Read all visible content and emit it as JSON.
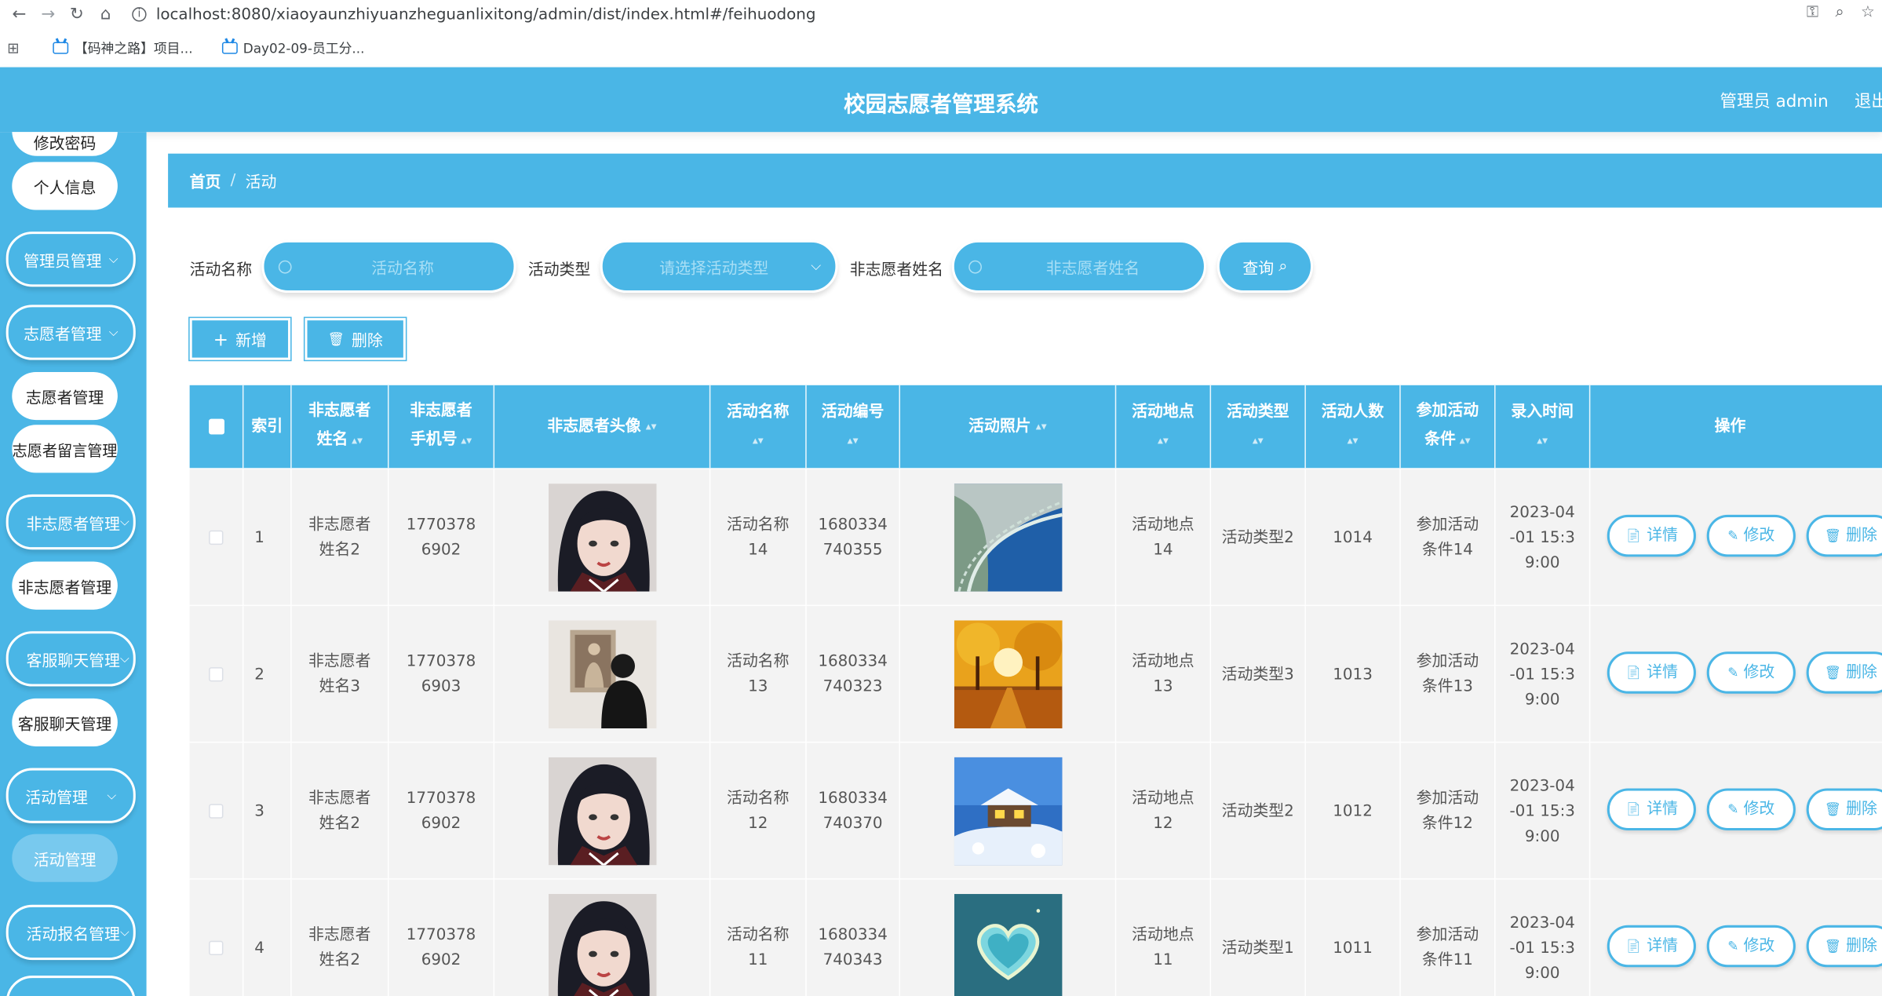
{
  "browser": {
    "url": "localhost:8080/xiaoyaunzhiyuanzheguanlixitong/admin/dist/index.html#/feihuodong",
    "bookmarks": [
      "【码神之路】项目...",
      "Day02-09-员工分..."
    ]
  },
  "header": {
    "title": "校园志愿者管理系统",
    "admin": "管理员 admin",
    "logout": "退出"
  },
  "sidebar": {
    "items": [
      {
        "label": "修改密码"
      },
      {
        "label": "个人信息"
      },
      {
        "label": "管理员管理"
      },
      {
        "label": "志愿者管理"
      },
      {
        "label": "志愿者管理"
      },
      {
        "label": "志愿者留言管理"
      },
      {
        "label": "非志愿者管理"
      },
      {
        "label": "非志愿者管理"
      },
      {
        "label": "客服聊天管理"
      },
      {
        "label": "客服聊天管理"
      },
      {
        "label": "活动管理"
      },
      {
        "label": "活动管理"
      },
      {
        "label": "活动报名管理"
      }
    ]
  },
  "breadcrumb": {
    "home": "首页",
    "current": "活动"
  },
  "filters": {
    "name_label": "活动名称",
    "name_placeholder": "活动名称",
    "type_label": "活动类型",
    "type_placeholder": "请选择活动类型",
    "person_label": "非志愿者姓名",
    "person_placeholder": "非志愿者姓名",
    "query": "查询"
  },
  "actions": {
    "add": "新增",
    "delete": "删除"
  },
  "table": {
    "headers": [
      "索引",
      "非志愿者姓名",
      "非志愿者手机号",
      "非志愿者头像",
      "活动名称",
      "活动编号",
      "活动照片",
      "活动地点",
      "活动类型",
      "活动人数",
      "参加活动条件",
      "录入时间",
      "操作"
    ],
    "ops": {
      "detail": "详情",
      "edit": "修改",
      "delete": "删除"
    },
    "rows": [
      {
        "index": "1",
        "name": "非志愿者姓名2",
        "phone": "17703786902",
        "avatar": "girl-portrait",
        "activity": "活动名称14",
        "code": "1680334740355",
        "photo": "coastline",
        "place": "活动地点14",
        "type": "活动类型2",
        "count": "1014",
        "condition": "参加活动条件14",
        "time": "2023-04-01 15:39:00"
      },
      {
        "index": "2",
        "name": "非志愿者姓名3",
        "phone": "17703786903",
        "avatar": "gallery-visitor",
        "activity": "活动名称13",
        "code": "1680334740323",
        "photo": "autumn-trees",
        "place": "活动地点13",
        "type": "活动类型3",
        "count": "1013",
        "condition": "参加活动条件13",
        "time": "2023-04-01 15:39:00"
      },
      {
        "index": "3",
        "name": "非志愿者姓名2",
        "phone": "17703786902",
        "avatar": "girl-portrait",
        "activity": "活动名称12",
        "code": "1680334740370",
        "photo": "snow-house",
        "place": "活动地点12",
        "type": "活动类型2",
        "count": "1012",
        "condition": "参加活动条件12",
        "time": "2023-04-01 15:39:00"
      },
      {
        "index": "4",
        "name": "非志愿者姓名2",
        "phone": "17703786902",
        "avatar": "girl-portrait",
        "activity": "活动名称11",
        "code": "1680334740343",
        "photo": "heart-island",
        "place": "活动地点11",
        "type": "活动类型1",
        "count": "1011",
        "condition": "参加活动条件11",
        "time": "2023-04-01 15:39:00"
      }
    ]
  }
}
